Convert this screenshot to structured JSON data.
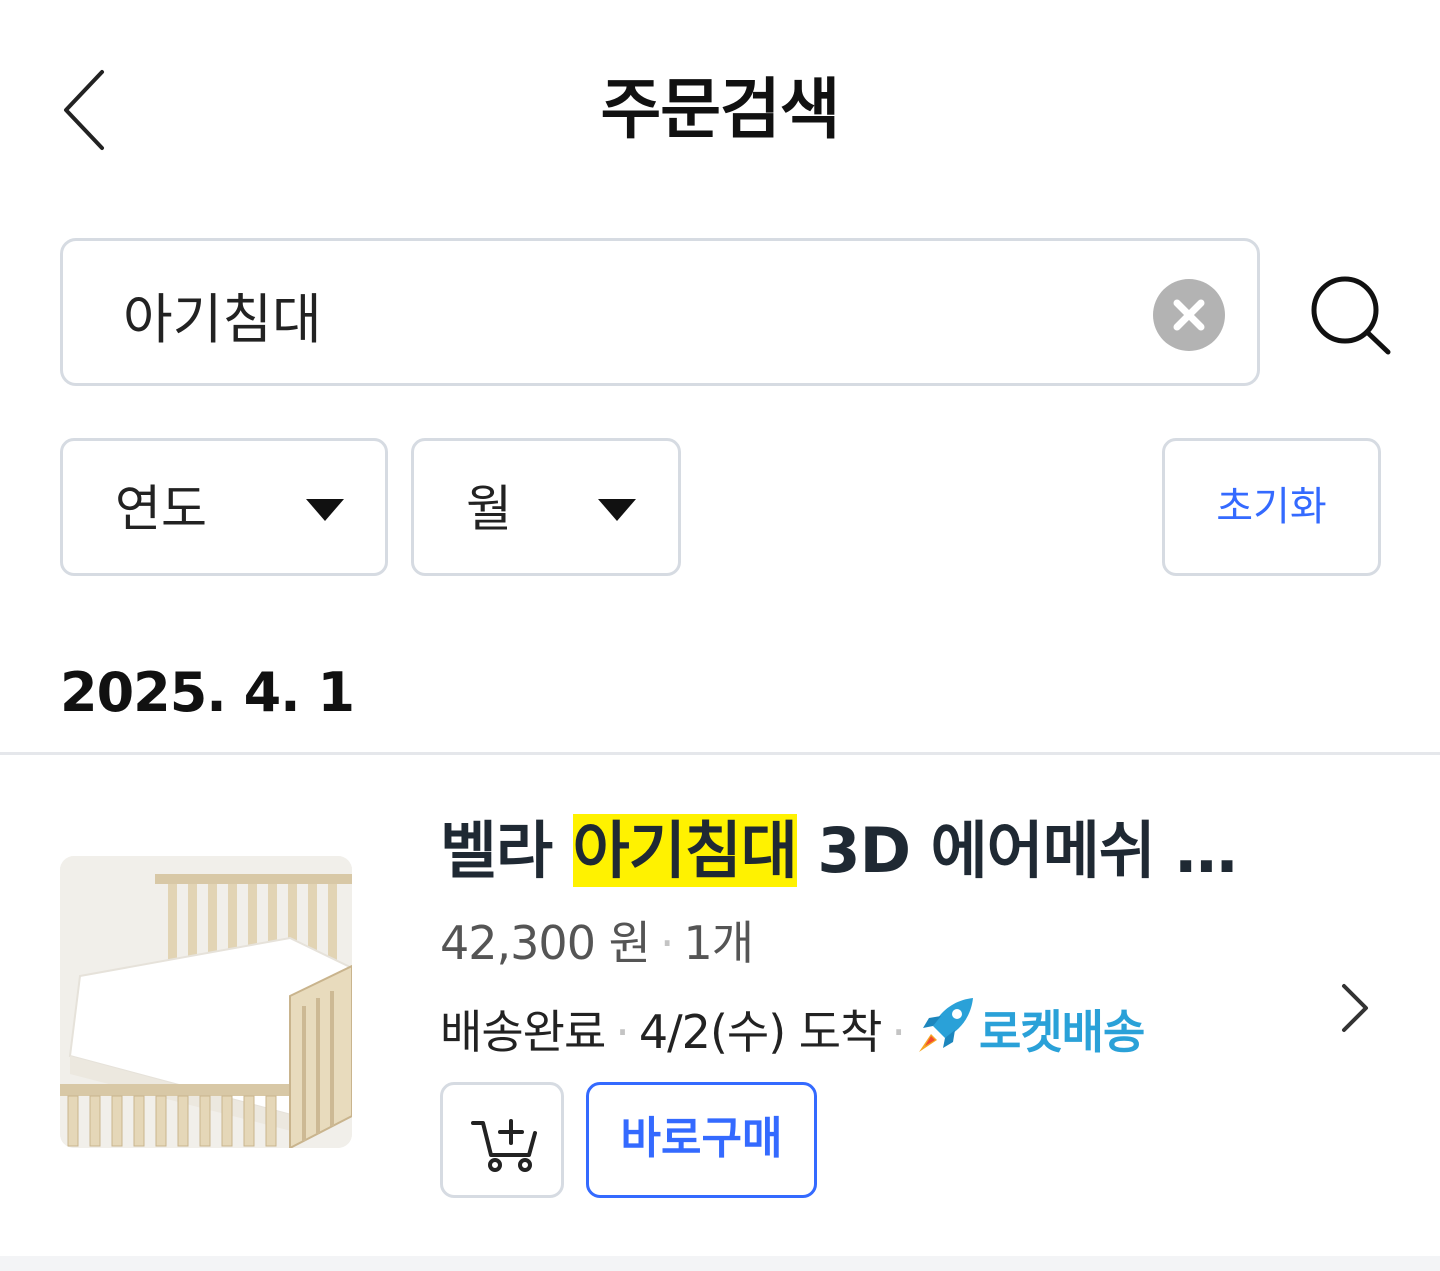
{
  "header": {
    "title": "주문검색",
    "back_icon": "chevron-left-icon"
  },
  "search": {
    "value": "아기침대",
    "clear_icon": "close-circle-icon",
    "search_icon": "search-icon"
  },
  "filters": {
    "year_label": "연도",
    "month_label": "월",
    "reset_label": "초기화",
    "caret_icon": "caret-down-icon"
  },
  "order": {
    "date": "2025. 4. 1",
    "item": {
      "name_prefix": "벨라 ",
      "name_highlight": "아기침대",
      "name_suffix": " 3D 에어메쉬 …",
      "price": "42,300 원",
      "quantity": "1개",
      "status": "배송완료",
      "arrival": "4/2(수) 도착",
      "delivery_badge": "로켓배송",
      "buy_now_label": "바로구매",
      "thumbnail_icon": "baby-crib-image",
      "cart_icon": "cart-plus-icon",
      "detail_icon": "chevron-right-icon"
    }
  },
  "colors": {
    "accent": "#346aff",
    "highlight": "#fff200",
    "rocket": "#2aa1d8",
    "border": "#d6dbe2"
  }
}
